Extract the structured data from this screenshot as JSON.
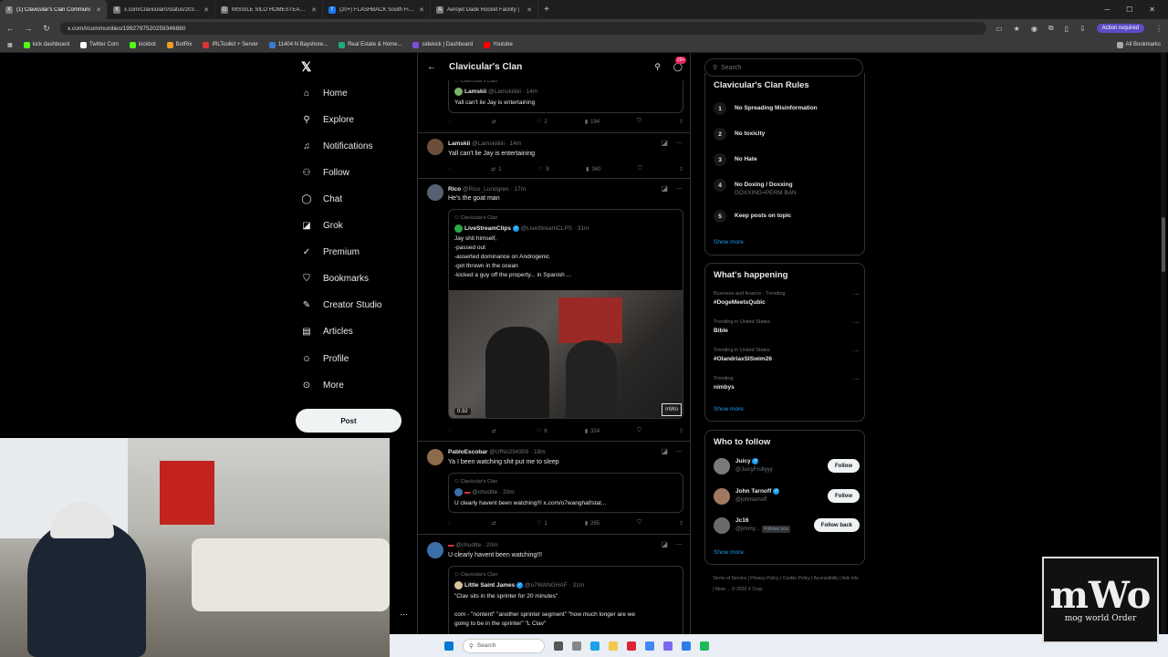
{
  "browser": {
    "tabs": [
      {
        "label": "(1) Clavicular's Clan Communi",
        "fav": "X"
      },
      {
        "label": "x.com/Clavicular0/status/20391",
        "fav": "X"
      },
      {
        "label": "MISSILE SILO HOMESTEAD - G",
        "fav": "G"
      },
      {
        "label": "(20+) FLASHBACK South Florid",
        "fav": "f"
      },
      {
        "label": "Aerojet Dade Rocket Facility |",
        "fav": "A"
      }
    ],
    "url": "x.com/i/communities/1992797520259346880",
    "action_required": "Action required",
    "bookmarks": [
      "kick dashboard",
      "Twitter Com",
      "kickbot",
      "BotRix",
      "IRLToolkit + Server",
      "11404 N Bayshore...",
      "Real Estate & Home...",
      "sidekick | Dashboard",
      "Youtube"
    ],
    "all_bookmarks": "All Bookmarks"
  },
  "nav": {
    "items": [
      {
        "label": "Home",
        "icon": "⌂",
        "name": "home"
      },
      {
        "label": "Explore",
        "icon": "⚲",
        "name": "explore"
      },
      {
        "label": "Notifications",
        "icon": "🔔",
        "name": "notifications"
      },
      {
        "label": "Follow",
        "icon": "👤",
        "name": "follow"
      },
      {
        "label": "Chat",
        "icon": "◯",
        "name": "chat"
      },
      {
        "label": "Grok",
        "icon": "◪",
        "name": "grok"
      },
      {
        "label": "Premium",
        "icon": "✓",
        "name": "premium"
      },
      {
        "label": "Bookmarks",
        "icon": "⛉",
        "name": "bookmarks"
      },
      {
        "label": "Creator Studio",
        "icon": "✎",
        "name": "creator-studio"
      },
      {
        "label": "Articles",
        "icon": "▤",
        "name": "articles"
      },
      {
        "label": "Profile",
        "icon": "☺",
        "name": "profile"
      },
      {
        "label": "More",
        "icon": "⋯",
        "name": "more"
      }
    ],
    "post_label": "Post"
  },
  "feed": {
    "title": "Clavicular's Clan",
    "badge": "20+",
    "post0": {
      "community": "Clavicular's Clan",
      "name": "Lamskii",
      "handle": "@Lamskiiiiiii · 14m",
      "text": "Yall can't lie Jay is entertaining",
      "replies": "",
      "reposts": "",
      "likes": "2",
      "views": "194"
    },
    "post1": {
      "name": "Lamskii",
      "handle": "@Lamskiiiiiii · 14m",
      "text": "Yall can't lie Jay is entertaining",
      "replies": "",
      "reposts": "1",
      "likes": "8",
      "views": "340"
    },
    "post2": {
      "name": "Rico",
      "handle": "@Rico_Lundgren · 17m",
      "text": "He's the goat man",
      "quote": {
        "community": "Clavicular's Clan",
        "name": "LiveStreamClips",
        "handle": "@LiveStreamCLPS · 31m",
        "lines": [
          "Jay shit himself,",
          "-passed out",
          "-asserted dominance on Androgenic",
          "-got thrown in the ocean",
          "-kicked a guy off the property... in Spanish ..."
        ],
        "duration": "0:32",
        "watermark": "mWo"
      },
      "replies": "",
      "reposts": "",
      "likes": "6",
      "views": "324"
    },
    "post3": {
      "name": "PabloEscobar",
      "handle": "@UfNo294359 · 18m",
      "text": "Ya I been watching shit put me to sleep",
      "quote": {
        "community": "Clavicular's Clan",
        "handle": "@chudIte · 20m",
        "text": "U clearly havent been watching!!! x.com/o7wanghaf/stat..."
      },
      "replies": "",
      "reposts": "",
      "likes": "1",
      "views": "265"
    },
    "post4": {
      "handle": "@chudIte · 20m",
      "text": "U clearly havent been watching!!!",
      "quote": {
        "community": "Clavicular's Clan",
        "name": "Little Saint James",
        "handle": "@o7WANGHAF · 31m",
        "lines": [
          "\"Clav sits in the sprinter for 20 minutes\"",
          "",
          "com - \"nontent\" \"another sprinter segment\" \"how much longer are we",
          "going to be in the sprinter\" \"L Clav\""
        ]
      }
    }
  },
  "right": {
    "search_placeholder": "Search",
    "rules_title": "Clavicular's Clan Rules",
    "rules": [
      {
        "num": "1",
        "title": "No Spreading Misinformation",
        "sub": ""
      },
      {
        "num": "2",
        "title": "No toxicity",
        "sub": ""
      },
      {
        "num": "3",
        "title": "No Hate",
        "sub": ""
      },
      {
        "num": "4",
        "title": "No Doxing / Doxxing",
        "sub": "DOXXING=PERM BAN"
      },
      {
        "num": "5",
        "title": "Keep posts on topic",
        "sub": ""
      }
    ],
    "show_more": "Show more",
    "happening_title": "What's happening",
    "trends": [
      {
        "meta": "Business and finance · Trending",
        "name": "#DogeMeetsQubic"
      },
      {
        "meta": "Trending in United States",
        "name": "Bible"
      },
      {
        "meta": "Trending in United States",
        "name": "#OlandriaxSISwim26"
      },
      {
        "meta": "Trending",
        "name": "nimbys"
      }
    ],
    "who_title": "Who to follow",
    "who": [
      {
        "name": "Juicy",
        "handle": "@JuicyFruityyy",
        "btn": "Follow",
        "follows_you": ""
      },
      {
        "name": "John Tarnoff",
        "handle": "@johntarnoff",
        "btn": "Follow",
        "follows_you": ""
      },
      {
        "name": "Jc16",
        "handle": "@jimmy...",
        "btn": "Follow back",
        "follows_you": "Follows you"
      }
    ],
    "footer": "Terms of Service | Privacy Policy | Cookie Policy | Accessibility | Ads info | More ... © 2026 X Corp."
  },
  "taskbar": {
    "search": "Search"
  },
  "logo": {
    "big": "mWo",
    "small": "mog world Order"
  }
}
